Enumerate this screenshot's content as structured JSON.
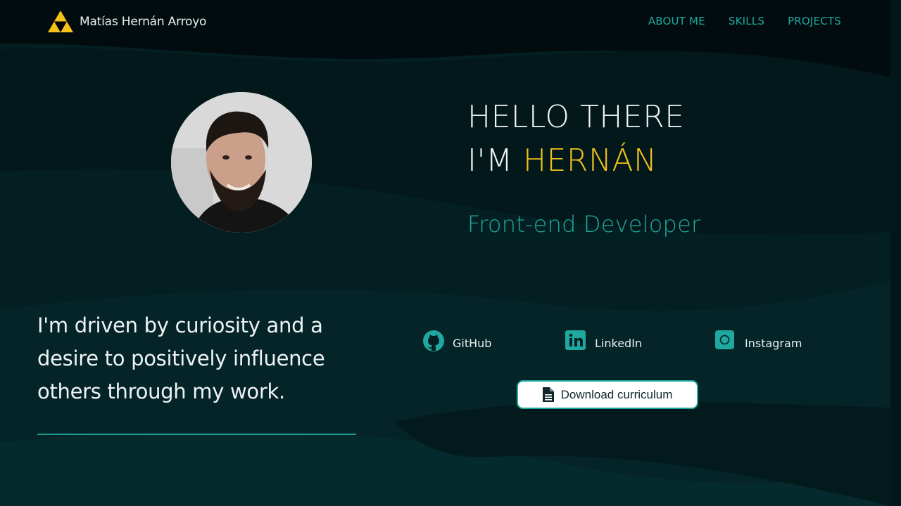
{
  "brand": {
    "name": "Matías Hernán Arroyo",
    "logo_icon": "triforce-icon",
    "logo_color": "#f2c21a"
  },
  "nav": {
    "items": [
      {
        "label": "ABOUT ME"
      },
      {
        "label": "SKILLS"
      },
      {
        "label": "PROJECTS"
      }
    ]
  },
  "hero": {
    "line1": "HELLO THERE",
    "line2_prefix": "I'M ",
    "name": "HERNÁN",
    "role": "Front-end Developer"
  },
  "about": {
    "tagline": "I'm driven by curiosity and a desire to positively influence others through my work."
  },
  "social": [
    {
      "label": "GitHub",
      "icon": "github-icon"
    },
    {
      "label": "LinkedIn",
      "icon": "linkedin-icon"
    },
    {
      "label": "Instagram",
      "icon": "instagram-icon"
    }
  ],
  "cv": {
    "label": "Download curriculum",
    "icon": "document-icon"
  },
  "colors": {
    "accent": "#1fa8a0",
    "highlight": "#f2c21a",
    "background": "#03161a"
  }
}
